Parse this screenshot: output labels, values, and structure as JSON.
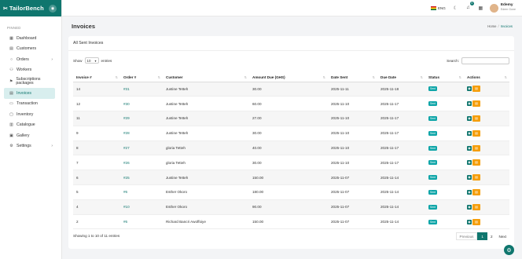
{
  "brand": {
    "name": "TailorBench"
  },
  "sidebar": {
    "section_label": "PINNED",
    "items": [
      {
        "label": "Dashboard",
        "icon": "dashboard-icon"
      },
      {
        "label": "Customers",
        "icon": "customers-icon"
      },
      {
        "label": "Orders",
        "icon": "orders-icon",
        "has_children": true
      },
      {
        "label": "Workers",
        "icon": "workers-icon"
      },
      {
        "label": "Subscriptions packages",
        "icon": "subscriptions-icon"
      },
      {
        "label": "Invoices",
        "icon": "invoices-icon",
        "active": true
      },
      {
        "label": "Transaction",
        "icon": "transaction-icon"
      },
      {
        "label": "Inventory",
        "icon": "inventory-icon"
      },
      {
        "label": "Catalogue",
        "icon": "catalogue-icon"
      },
      {
        "label": "Gallery",
        "icon": "gallery-icon"
      },
      {
        "label": "Settings",
        "icon": "settings-icon",
        "has_children": true
      }
    ]
  },
  "topbar": {
    "language": "ENG",
    "notification_count": "0",
    "user_name": "Edemy",
    "user_role": "Edem Gone"
  },
  "page": {
    "title": "Invoices",
    "breadcrumb_home": "Home",
    "breadcrumb_sep": "/",
    "breadcrumb_current": "Invoices"
  },
  "card": {
    "title": "All Sent Invoices",
    "show_label": "Show",
    "entries_value": "10",
    "entries_label": "entries",
    "search_label": "Search:"
  },
  "table": {
    "columns": [
      "Invoice #",
      "Order #",
      "Customer",
      "Amount Due (GHS)",
      "Date Sent",
      "Due Date",
      "Status",
      "Actions"
    ],
    "rows": [
      {
        "invoice": "14",
        "order": "#31",
        "customer": "Justine Tetteh",
        "amount": "30.00",
        "date_sent": "2025-11-11",
        "due_date": "2025-11-18",
        "status": "Sent"
      },
      {
        "invoice": "12",
        "order": "#30",
        "customer": "Justine Tetteh",
        "amount": "60.00",
        "date_sent": "2025-11-10",
        "due_date": "2025-11-17",
        "status": "Sent"
      },
      {
        "invoice": "11",
        "order": "#29",
        "customer": "Justine Tetteh",
        "amount": "27.00",
        "date_sent": "2025-11-10",
        "due_date": "2025-11-17",
        "status": "Sent"
      },
      {
        "invoice": "9",
        "order": "#28",
        "customer": "Justine Tetteh",
        "amount": "30.00",
        "date_sent": "2025-11-10",
        "due_date": "2025-11-17",
        "status": "Sent"
      },
      {
        "invoice": "8",
        "order": "#27",
        "customer": "gloria Tetteh",
        "amount": "40.00",
        "date_sent": "2025-11-10",
        "due_date": "2025-11-17",
        "status": "Sent"
      },
      {
        "invoice": "7",
        "order": "#26",
        "customer": "gloria Tetteh",
        "amount": "30.00",
        "date_sent": "2025-11-10",
        "due_date": "2025-11-17",
        "status": "Sent"
      },
      {
        "invoice": "6",
        "order": "#25",
        "customer": "Justine Tetteh",
        "amount": "150.00",
        "date_sent": "2025-11-07",
        "due_date": "2025-11-14",
        "status": "Sent"
      },
      {
        "invoice": "5",
        "order": "#6",
        "customer": "Esther Okoro",
        "amount": "180.00",
        "date_sent": "2025-11-07",
        "due_date": "2025-11-14",
        "status": "Sent"
      },
      {
        "invoice": "4",
        "order": "#10",
        "customer": "Esther Okoro",
        "amount": "90.00",
        "date_sent": "2025-11-07",
        "due_date": "2025-11-14",
        "status": "Sent"
      },
      {
        "invoice": "2",
        "order": "#6",
        "customer": "Richard Bancri Awoffoiye",
        "amount": "150.00",
        "date_sent": "2025-11-07",
        "due_date": "2025-11-14",
        "status": "Sent"
      }
    ]
  },
  "footer": {
    "info": "Showing 1 to 10 of 11 entries",
    "previous": "Previous",
    "page1": "1",
    "page2": "2",
    "next": "Next"
  },
  "colors": {
    "accent": "#0f766e",
    "status": "#0ea5a8",
    "edit": "#f59e0b"
  }
}
